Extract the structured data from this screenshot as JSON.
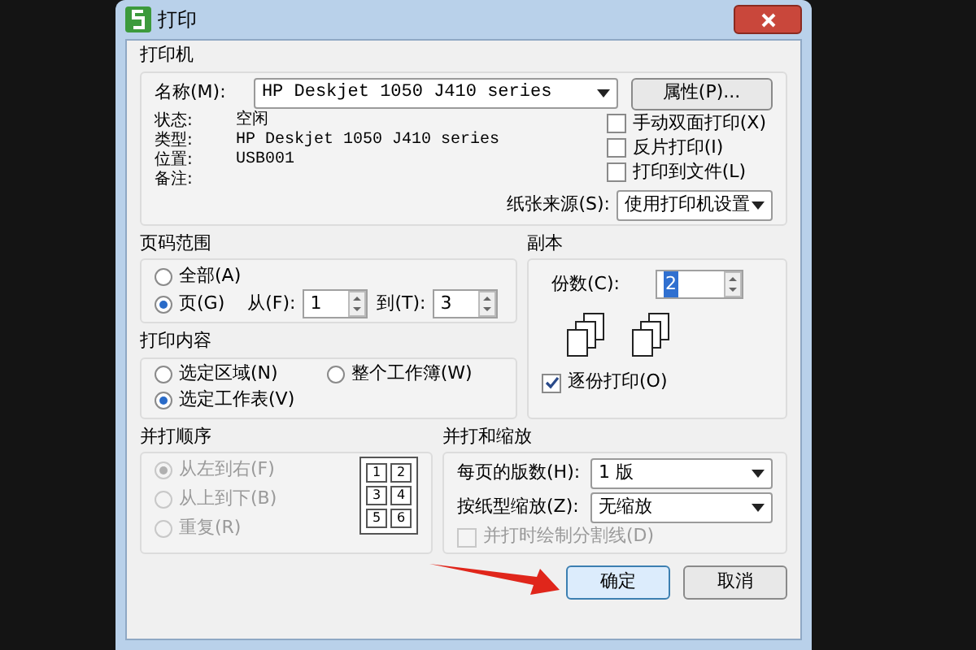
{
  "window": {
    "title": "打印"
  },
  "printer": {
    "title": "打印机",
    "name_label": "名称(M):",
    "name_value": "HP Deskjet 1050 J410 series",
    "properties_button": "属性(P)...",
    "info": [
      {
        "label": "状态:",
        "value": "空闲"
      },
      {
        "label": "类型:",
        "value": "HP Deskjet 1050 J410 series"
      },
      {
        "label": "位置:",
        "value": "USB001"
      },
      {
        "label": "备注:"
      }
    ],
    "options": [
      {
        "label": "手动双面打印(X)",
        "checked": false
      },
      {
        "label": "反片打印(I)",
        "checked": false
      },
      {
        "label": "打印到文件(L)",
        "checked": false
      }
    ],
    "paper_source_label": "纸张来源(S):",
    "paper_source_value": "使用打印机设置"
  },
  "page_range": {
    "title": "页码范围",
    "options": [
      {
        "label": "全部(A)",
        "selected": false
      },
      {
        "label": "页(G)",
        "selected": true
      }
    ],
    "from_label": "从(F):",
    "from_value": "1",
    "to_label": "到(T):",
    "to_value": "3"
  },
  "copies": {
    "title": "副本",
    "count_label": "份数(C):",
    "count_value": "2",
    "collate": {
      "label": "逐份打印(O)",
      "checked": true
    }
  },
  "print_content": {
    "title": "打印内容",
    "options": [
      {
        "label": "选定区域(N)",
        "selected": false
      },
      {
        "label": "整个工作簿(W)",
        "selected": false
      },
      {
        "label": "选定工作表(V)",
        "selected": true
      }
    ]
  },
  "collation_order": {
    "title": "并打顺序",
    "options": [
      {
        "label": "从左到右(F)",
        "selected": true,
        "disabled": true
      },
      {
        "label": "从上到下(B)",
        "selected": false,
        "disabled": true
      },
      {
        "label": "重复(R)",
        "selected": false,
        "disabled": true
      }
    ],
    "grid_numbers": [
      "1",
      "2",
      "3",
      "4",
      "5",
      "6"
    ]
  },
  "nup": {
    "title": "并打和缩放",
    "pages_label": "每页的版数(H):",
    "pages_value": "1 版",
    "scale_label": "按纸型缩放(Z):",
    "scale_value": "无缩放",
    "draw_borders": {
      "label": "并打时绘制分割线(D)",
      "checked": false,
      "disabled": true
    }
  },
  "buttons": [
    {
      "label": "确定",
      "default": true
    },
    {
      "label": "取消",
      "default": false
    }
  ]
}
